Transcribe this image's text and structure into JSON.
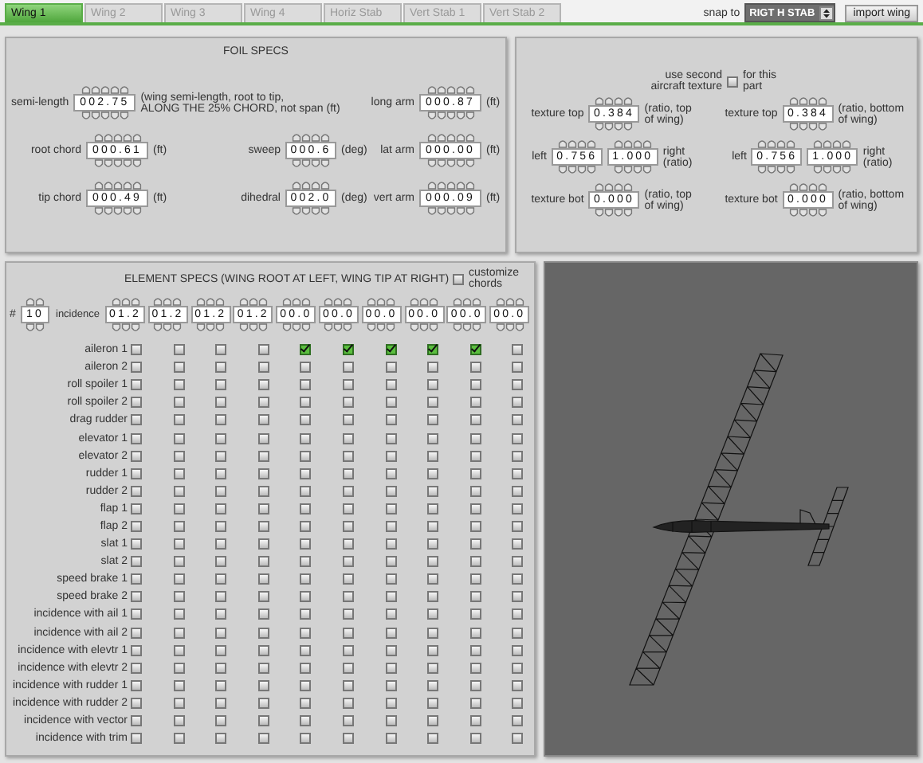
{
  "tabs": [
    {
      "label": "Wing 1",
      "selected": true
    },
    {
      "label": "Wing 2",
      "selected": false
    },
    {
      "label": "Wing 3",
      "selected": false
    },
    {
      "label": "Wing 4",
      "selected": false
    },
    {
      "label": "Horiz Stab",
      "selected": false
    },
    {
      "label": "Vert Stab 1",
      "selected": false
    },
    {
      "label": "Vert Stab 2",
      "selected": false
    }
  ],
  "snap": {
    "label": "snap to",
    "value": "RIGT H STAB"
  },
  "import_button": "import wing",
  "foil_specs": {
    "title": "FOIL SPECS",
    "columns": [
      [
        {
          "label": "semi-length",
          "value": "002.75",
          "unit": "(wing semi-length, root to tip,\nALONG THE 25% CHORD, not span (ft)"
        },
        {
          "label": "root chord",
          "value": "000.61",
          "unit": "(ft)"
        },
        {
          "label": "tip chord",
          "value": "000.49",
          "unit": "(ft)"
        }
      ],
      [
        {
          "label": "sweep",
          "value": "000.6",
          "unit": "(deg)"
        },
        {
          "label": "dihedral",
          "value": "002.0",
          "unit": "(deg)"
        }
      ],
      [
        {
          "label": "long arm",
          "value": "000.87",
          "unit": "(ft)"
        },
        {
          "label": "lat arm",
          "value": "000.00",
          "unit": "(ft)"
        },
        {
          "label": "vert arm",
          "value": "000.09",
          "unit": "(ft)"
        }
      ]
    ]
  },
  "texture": {
    "second_texture": {
      "label": "use second aircraft texture",
      "checked": false,
      "suffix": "for this part"
    },
    "columns": [
      [
        {
          "kind": "single",
          "label": "texture top",
          "value": "0.384",
          "note": "(ratio, top of wing)"
        },
        {
          "kind": "pair",
          "label": "left",
          "values": [
            "0.756",
            "1.000"
          ],
          "note": "right (ratio)"
        },
        {
          "kind": "single",
          "label": "texture bot",
          "value": "0.000",
          "note": "(ratio, top of wing)"
        }
      ],
      [
        {
          "kind": "single",
          "label": "texture top",
          "value": "0.384",
          "note": "(ratio, bottom of wing)"
        },
        {
          "kind": "pair",
          "label": "left",
          "values": [
            "0.756",
            "1.000"
          ],
          "note": "right (ratio)"
        },
        {
          "kind": "single",
          "label": "texture bot",
          "value": "0.000",
          "note": "(ratio, bottom of wing)"
        }
      ]
    ]
  },
  "element_specs": {
    "title": "ELEMENT SPECS (WING ROOT AT LEFT, WING TIP AT RIGHT)",
    "customize_chords": {
      "label": "customize chords",
      "checked": false
    },
    "count": {
      "label": "#",
      "value": "10"
    },
    "incidence": {
      "label": "incidence",
      "values": [
        "01.2",
        "01.2",
        "01.2",
        "01.2",
        "00.0",
        "00.0",
        "00.0",
        "00.0",
        "00.0",
        "00.0"
      ]
    },
    "rows": [
      {
        "label": "aileron 1",
        "checks": [
          false,
          false,
          false,
          false,
          true,
          true,
          true,
          true,
          true,
          false
        ]
      },
      {
        "label": "aileron 2",
        "checks": [
          false,
          false,
          false,
          false,
          false,
          false,
          false,
          false,
          false,
          false
        ]
      },
      {
        "label": "roll spoiler 1",
        "checks": [
          false,
          false,
          false,
          false,
          false,
          false,
          false,
          false,
          false,
          false
        ]
      },
      {
        "label": "roll spoiler 2",
        "checks": [
          false,
          false,
          false,
          false,
          false,
          false,
          false,
          false,
          false,
          false
        ]
      },
      {
        "label": "drag rudder",
        "checks": [
          false,
          false,
          false,
          false,
          false,
          false,
          false,
          false,
          false,
          false
        ]
      },
      {
        "label": "elevator 1",
        "checks": [
          false,
          false,
          false,
          false,
          false,
          false,
          false,
          false,
          false,
          false
        ]
      },
      {
        "label": "elevator 2",
        "checks": [
          false,
          false,
          false,
          false,
          false,
          false,
          false,
          false,
          false,
          false
        ]
      },
      {
        "label": "rudder 1",
        "checks": [
          false,
          false,
          false,
          false,
          false,
          false,
          false,
          false,
          false,
          false
        ]
      },
      {
        "label": "rudder 2",
        "checks": [
          false,
          false,
          false,
          false,
          false,
          false,
          false,
          false,
          false,
          false
        ]
      },
      {
        "label": "flap 1",
        "checks": [
          false,
          false,
          false,
          false,
          false,
          false,
          false,
          false,
          false,
          false
        ]
      },
      {
        "label": "flap 2",
        "checks": [
          false,
          false,
          false,
          false,
          false,
          false,
          false,
          false,
          false,
          false
        ]
      },
      {
        "label": "slat 1",
        "checks": [
          false,
          false,
          false,
          false,
          false,
          false,
          false,
          false,
          false,
          false
        ]
      },
      {
        "label": "slat 2",
        "checks": [
          false,
          false,
          false,
          false,
          false,
          false,
          false,
          false,
          false,
          false
        ]
      },
      {
        "label": "speed brake 1",
        "checks": [
          false,
          false,
          false,
          false,
          false,
          false,
          false,
          false,
          false,
          false
        ]
      },
      {
        "label": "speed brake 2",
        "checks": [
          false,
          false,
          false,
          false,
          false,
          false,
          false,
          false,
          false,
          false
        ]
      },
      {
        "label": "incidence with ail 1",
        "checks": [
          false,
          false,
          false,
          false,
          false,
          false,
          false,
          false,
          false,
          false
        ]
      },
      {
        "label": "incidence with ail 2",
        "checks": [
          false,
          false,
          false,
          false,
          false,
          false,
          false,
          false,
          false,
          false
        ]
      },
      {
        "label": "incidence with elevtr 1",
        "checks": [
          false,
          false,
          false,
          false,
          false,
          false,
          false,
          false,
          false,
          false
        ]
      },
      {
        "label": "incidence with elevtr 2",
        "checks": [
          false,
          false,
          false,
          false,
          false,
          false,
          false,
          false,
          false,
          false
        ]
      },
      {
        "label": "incidence with rudder 1",
        "checks": [
          false,
          false,
          false,
          false,
          false,
          false,
          false,
          false,
          false,
          false
        ]
      },
      {
        "label": "incidence with rudder 2",
        "checks": [
          false,
          false,
          false,
          false,
          false,
          false,
          false,
          false,
          false,
          false
        ]
      },
      {
        "label": "incidence with vector",
        "checks": [
          false,
          false,
          false,
          false,
          false,
          false,
          false,
          false,
          false,
          false
        ]
      },
      {
        "label": "incidence with trim",
        "checks": [
          false,
          false,
          false,
          false,
          false,
          false,
          false,
          false,
          false,
          false
        ]
      }
    ]
  }
}
